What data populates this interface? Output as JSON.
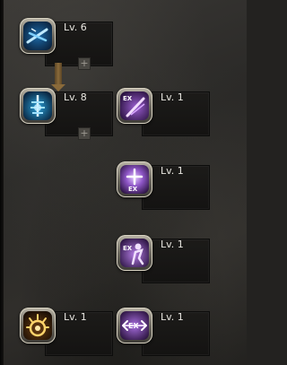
{
  "skills": [
    {
      "id": "skill-a",
      "level_text": "Lv. 6",
      "icon": "crossed-blades-icon",
      "has_plus": true
    },
    {
      "id": "skill-b",
      "level_text": "Lv. 8",
      "icon": "anchor-burst-icon",
      "has_plus": true
    },
    {
      "id": "skill-c",
      "level_text": "Lv. 1",
      "icon": "ex-slash-icon",
      "has_plus": false,
      "badge": "EX"
    },
    {
      "id": "skill-d",
      "level_text": "Lv. 1",
      "icon": "ex-cross-icon",
      "has_plus": false,
      "badge": "EX"
    },
    {
      "id": "skill-e",
      "level_text": "Lv. 1",
      "icon": "ex-silhouette-icon",
      "has_plus": false,
      "badge": "EX"
    },
    {
      "id": "skill-f",
      "level_text": "Lv. 1",
      "icon": "sunburst-icon",
      "has_plus": false
    },
    {
      "id": "skill-g",
      "level_text": "Lv. 1",
      "icon": "ex-arrows-icon",
      "has_plus": false,
      "badge": "EX"
    }
  ],
  "plus_label": "+",
  "colors": {
    "blue_glow": "#7fd0ff",
    "purple_glow": "#d7a6ff",
    "gold_glow": "#ffd36a",
    "connector": "#8a6a3a"
  }
}
